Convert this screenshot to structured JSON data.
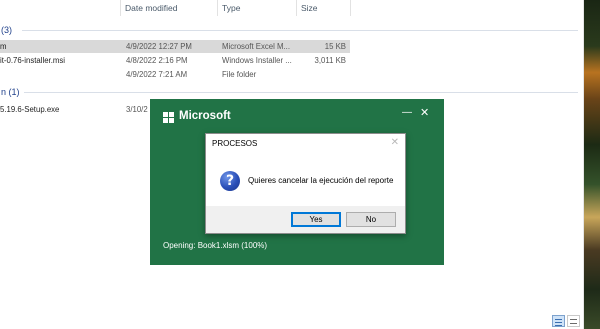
{
  "explorer": {
    "columns": {
      "date": "Date modified",
      "type": "Type",
      "size": "Size"
    },
    "groups": [
      {
        "label": "(3)"
      },
      {
        "label": "n (1)"
      }
    ],
    "rows": [
      {
        "name": "m",
        "date": "4/9/2022 12:27 PM",
        "type": "Microsoft Excel M...",
        "size": "15 KB",
        "selected": true
      },
      {
        "name": "it-0.76-installer.msi",
        "date": "4/8/2022 2:16 PM",
        "type": "Windows Installer ...",
        "size": "3,011 KB"
      },
      {
        "name": "",
        "date": "4/9/2022 7:21 AM",
        "type": "File folder",
        "size": ""
      },
      {
        "name": "5.19.6-Setup.exe",
        "date": "3/10/2",
        "type": "",
        "size": ""
      }
    ]
  },
  "splash": {
    "brand": "Microsoft",
    "minimize_glyph": "—",
    "close_glyph": "✕",
    "status": "Opening: Book1.xlsm (100%)",
    "background": "#217346"
  },
  "dialog": {
    "title": "PROCESOS",
    "close_glyph": "✕",
    "icon": "question-icon",
    "icon_glyph": "?",
    "message": "Quieres cancelar la ejecución del reporte",
    "yes_label": "Yes",
    "no_label": "No"
  }
}
